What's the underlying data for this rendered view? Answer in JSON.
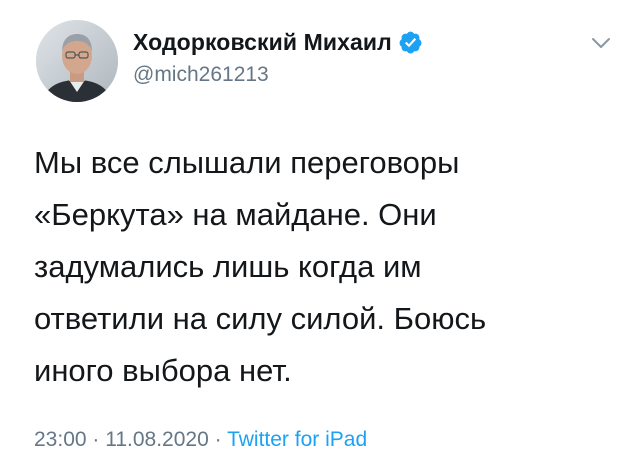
{
  "author": {
    "display_name": "Ходорковский Михаил",
    "handle": "@mich261213",
    "verified": true
  },
  "tweet": {
    "lines": [
      "Мы все слышали переговоры",
      "«Беркута» на майдане. Они",
      "задумались лишь когда им",
      "ответили на силу силой. Боюсь",
      "иного выбора нет."
    ]
  },
  "meta": {
    "time": "23:00",
    "separator1": " · ",
    "date": "11.08.2020",
    "separator2": " · ",
    "source": "Twitter for iPad"
  },
  "icons": {
    "verified": "verified-badge-icon",
    "menu": "chevron-down-icon"
  },
  "colors": {
    "text": "#14171a",
    "secondary": "#657786",
    "accent": "#1da1f2"
  }
}
